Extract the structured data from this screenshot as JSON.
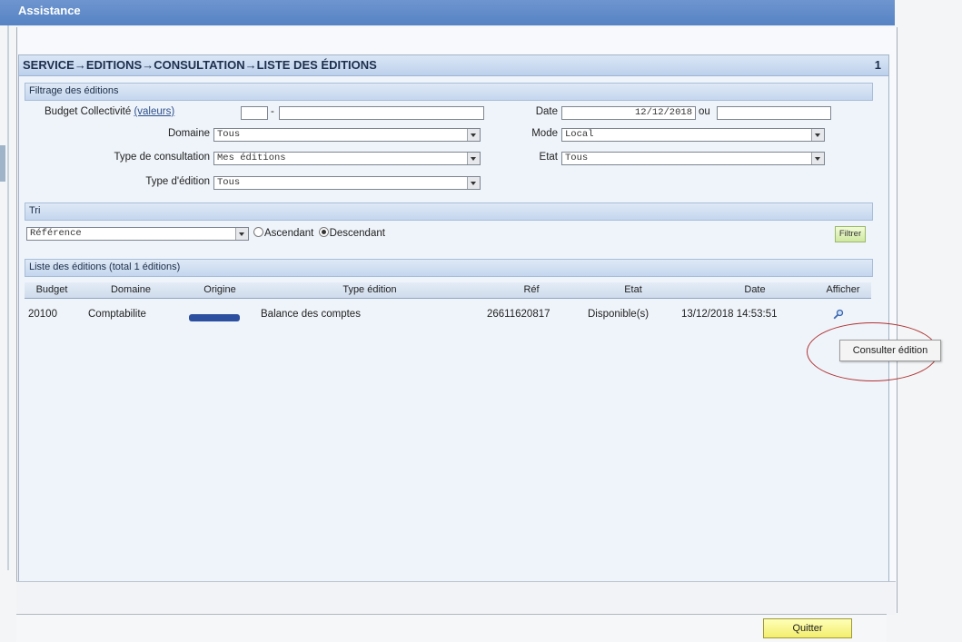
{
  "app": {
    "title": "Assistance"
  },
  "page": {
    "breadcrumb": "SERVICE→EDITIONS→CONSULTATION→LISTE DES ÉDITIONS",
    "page_number": "1"
  },
  "filter": {
    "section_title": "Filtrage des éditions",
    "budget_label": "Budget Collectivité",
    "budget_link": "(valeurs)",
    "budget_value": "",
    "budget_separator": "-",
    "budget_value2": "",
    "domaine_label": "Domaine",
    "domaine_value": "Tous",
    "type_consult_label": "Type de consultation",
    "type_consult_value": "Mes éditions",
    "type_edition_label": "Type d'édition",
    "type_edition_value": "Tous",
    "date_label": "Date",
    "date_value": "12/12/2018",
    "date_or": "ou",
    "date_value2": "",
    "mode_label": "Mode",
    "mode_value": "Local",
    "etat_label": "Etat",
    "etat_value": "Tous"
  },
  "sort": {
    "section_title": "Tri",
    "field_value": "Référence",
    "asc_label": "Ascendant",
    "desc_label": "Descendant",
    "selected": "desc",
    "filter_button": "Filtrer"
  },
  "list": {
    "section_title": "Liste des éditions (total 1 éditions)",
    "columns": [
      "Budget",
      "Domaine",
      "Origine",
      "Type édition",
      "Réf",
      "Etat",
      "Date",
      "Afficher"
    ],
    "rows": [
      {
        "budget": "20100",
        "domaine": "Comptabilite",
        "origine": "",
        "type": "Balance des comptes",
        "ref": "26611620817",
        "etat": "Disponible(s)",
        "date": "13/12/2018 14:53:51",
        "afficher_icon": "magnifier-icon"
      }
    ]
  },
  "tooltip": {
    "text": "Consulter édition"
  },
  "footer": {
    "quit_button": "Quitter"
  },
  "colors": {
    "header_blue": "#5683c4",
    "section_blue": "#c4d6ee",
    "highlight_red": "#b03232",
    "quit_yellow": "#f3ee6e"
  }
}
